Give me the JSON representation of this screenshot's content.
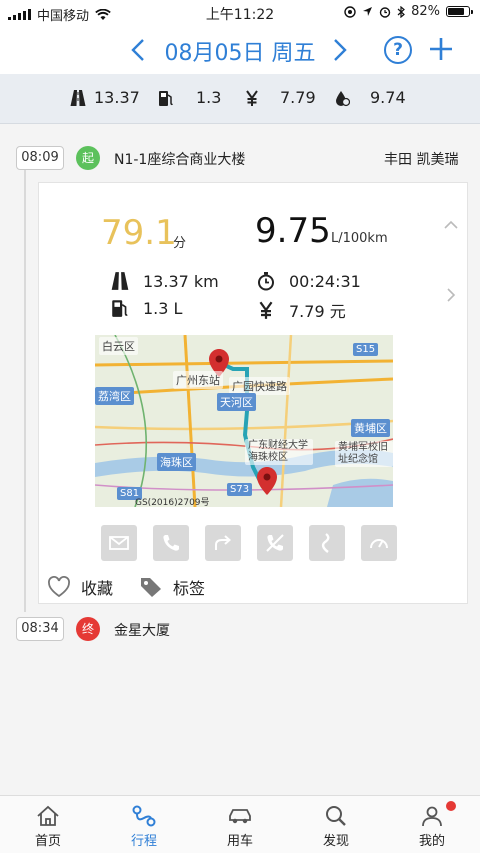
{
  "status_bar": {
    "carrier": "中国移动",
    "time": "上午11:22",
    "battery": "82%",
    "battery_level": 0.82
  },
  "header": {
    "date": "08月05日 周五",
    "help": "?",
    "add": "+"
  },
  "summary": {
    "distance": "13.37",
    "fuel": "1.3",
    "cost": "7.79",
    "consumption": "9.74"
  },
  "trip": {
    "start_time": "08:09",
    "start_badge": "起",
    "start_place": "N1-1座综合商业大楼",
    "car": "丰田 凯美瑞",
    "end_time": "08:34",
    "end_badge": "终",
    "end_place": "金星大厦"
  },
  "card": {
    "score": "79.1",
    "score_unit": "分",
    "fuel_rate": "9.75",
    "fuel_rate_unit": "L/100km",
    "distance": "13.37 km",
    "duration": "00:24:31",
    "fuel": "1.3 L",
    "cost": "7.79 元",
    "favorite": "收藏",
    "tag": "标签"
  },
  "map": {
    "labels": {
      "baiyun": "白云区",
      "guangzhou_east": "广州东站",
      "liwan": "荔湾区",
      "tianhe": "天河区",
      "haizhu": "海珠区",
      "huangpu": "黄埔区",
      "school": "广东财经大学海珠校区",
      "whampoa": "黄埔军校旧址纪念馆",
      "road": "广园快速路",
      "s15": "S15",
      "s81": "S81",
      "s73": "S73",
      "credit": "GS(2016)2709号"
    }
  },
  "tabs": [
    {
      "label": "首页",
      "icon": "home-icon"
    },
    {
      "label": "行程",
      "icon": "route-icon"
    },
    {
      "label": "用车",
      "icon": "car-icon"
    },
    {
      "label": "发现",
      "icon": "discover-icon"
    },
    {
      "label": "我的",
      "icon": "profile-icon"
    }
  ],
  "colors": {
    "accent": "#2f7fd6",
    "score": "#e8c25b",
    "start": "#5cc15c",
    "end": "#e53935"
  }
}
